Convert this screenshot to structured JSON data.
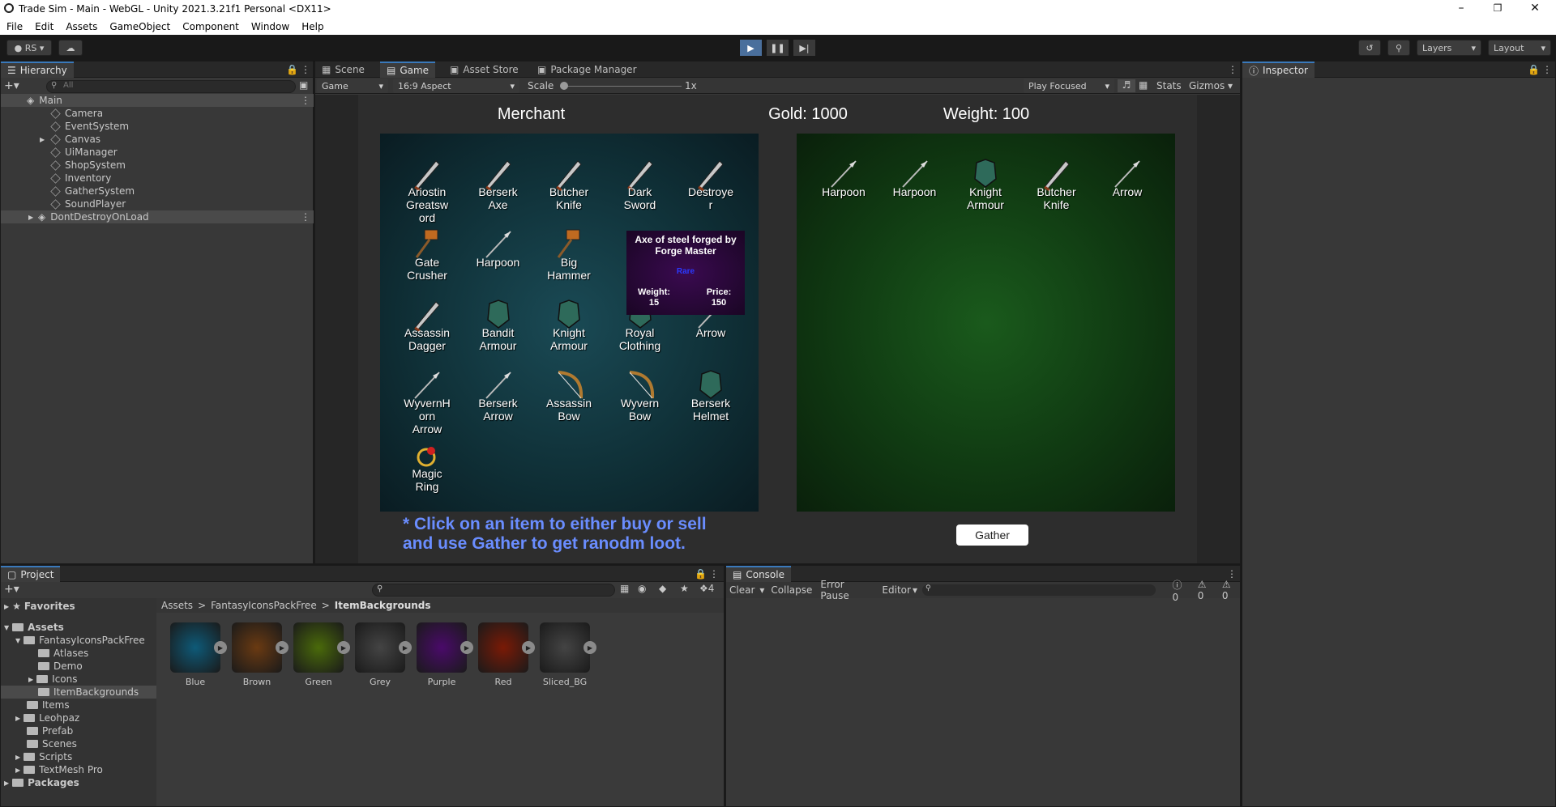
{
  "window": {
    "title": "Trade Sim - Main - WebGL - Unity 2021.3.21f1 Personal <DX11>"
  },
  "menu": [
    "File",
    "Edit",
    "Assets",
    "GameObject",
    "Component",
    "Window",
    "Help"
  ],
  "toolbar": {
    "account": "RS",
    "layers": "Layers",
    "layout": "Layout"
  },
  "hierarchy": {
    "tab": "Hierarchy",
    "search_placeholder": "All",
    "rows": [
      {
        "label": "Main",
        "scene": true
      },
      {
        "label": "Camera"
      },
      {
        "label": "EventSystem"
      },
      {
        "label": "Canvas",
        "expandable": true
      },
      {
        "label": "UiManager"
      },
      {
        "label": "ShopSystem"
      },
      {
        "label": "Inventory"
      },
      {
        "label": "GatherSystem"
      },
      {
        "label": "SoundPlayer"
      },
      {
        "label": "DontDestroyOnLoad",
        "scene": true
      }
    ]
  },
  "center_tabs": [
    "Scene",
    "Game",
    "Asset Store",
    "Package Manager"
  ],
  "game_bar": {
    "display": "Game",
    "aspect": "16:9 Aspect",
    "scale_label": "Scale",
    "scale_value": "1x",
    "play_mode": "Play Focused",
    "stats": "Stats",
    "gizmos": "Gizmos"
  },
  "game": {
    "merchant": "Merchant",
    "gold": "Gold: 1000",
    "weight": "Weight: 100",
    "hint": "* Click on an item to either buy or sell\nand use Gather to get ranodm loot.",
    "gather": "Gather",
    "shop_items": [
      "Ariostin\nGreatsw\nord",
      "Berserk\nAxe",
      "Butcher\nKnife",
      "Dark\nSword",
      "Destroye\nr",
      "Gate\nCrusher",
      "Harpoon",
      "Big\nHammer",
      "",
      "",
      "Assassin\nDagger",
      "Bandit\nArmour",
      "Knight\nArmour",
      "Royal\nClothing",
      "Arrow",
      "WyvernH\norn\nArrow",
      "Berserk\nArrow",
      "Assassin\nBow",
      "Wyvern\nBow",
      "Berserk\nHelmet",
      "Magic\nRing"
    ],
    "inventory_items": [
      "Harpoon",
      "Harpoon",
      "Knight\nArmour",
      "Butcher\nKnife",
      "Arrow"
    ],
    "tooltip": {
      "title": "Axe of steel forged by Forge Master",
      "rarity": "Rare",
      "weight": "Weight:\n15",
      "price": "Price:\n150"
    }
  },
  "inspector": {
    "tab": "Inspector"
  },
  "project": {
    "tab": "Project",
    "favorites": "Favorites",
    "assets": "Assets",
    "tree": [
      "FantasyIconsPackFree",
      "Atlases",
      "Demo",
      "Icons",
      "ItemBackgrounds",
      "Items",
      "Leohpaz",
      "Prefab",
      "Scenes",
      "Scripts",
      "TextMesh Pro"
    ],
    "packages": "Packages",
    "breadcrumb": [
      "Assets",
      "FantasyIconsPackFree",
      "ItemBackgrounds"
    ],
    "hidden_count": "4",
    "files": [
      {
        "name": "Blue",
        "color": "#0e5a78"
      },
      {
        "name": "Brown",
        "color": "#6a3a12"
      },
      {
        "name": "Green",
        "color": "#4a6a0a"
      },
      {
        "name": "Grey",
        "color": "#444444"
      },
      {
        "name": "Purple",
        "color": "#4a0a6a"
      },
      {
        "name": "Red",
        "color": "#7a1a06"
      },
      {
        "name": "Sliced_BG",
        "color": "#444444"
      }
    ]
  },
  "console": {
    "tab": "Console",
    "clear": "Clear",
    "collapse": "Collapse",
    "error_pause": "Error Pause",
    "editor": "Editor",
    "log": "0",
    "warn": "0",
    "err": "0"
  }
}
